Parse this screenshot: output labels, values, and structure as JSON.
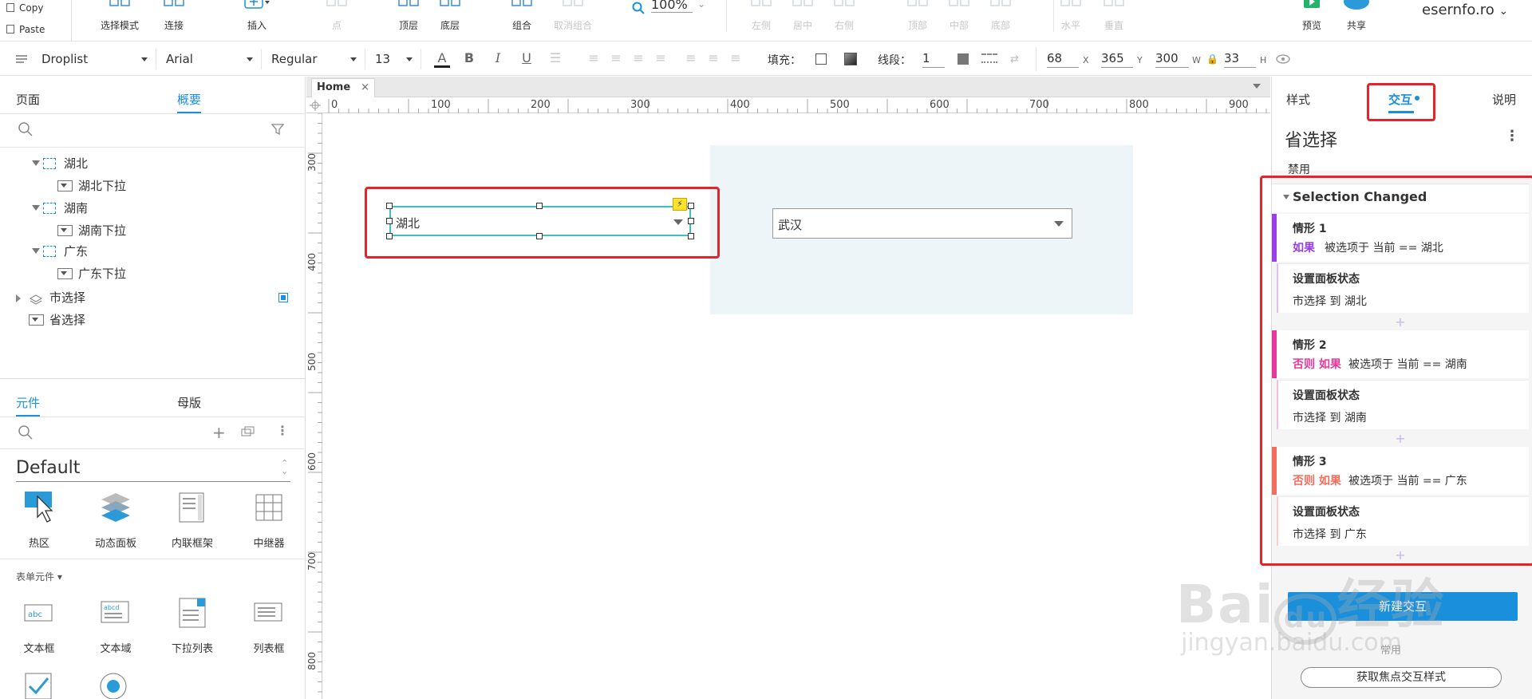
{
  "clipboard": {
    "copy_label": "Copy",
    "paste_label": "Paste"
  },
  "toolbar": {
    "tools": [
      {
        "label": "选择模式",
        "icon": "select-mode-icon"
      },
      {
        "label": "连接",
        "icon": "connect-icon"
      },
      {
        "label": "插入",
        "icon": "insert-icon"
      },
      {
        "label": "点",
        "icon": "point-icon"
      },
      {
        "label": "顶层",
        "icon": "bring-front-icon"
      },
      {
        "label": "底层",
        "icon": "send-back-icon"
      },
      {
        "label": "组合",
        "icon": "group-icon"
      },
      {
        "label": "取消组合",
        "icon": "ungroup-icon"
      },
      {
        "label": "左侧",
        "icon": "align-left-icon"
      },
      {
        "label": "居中",
        "icon": "align-center-icon"
      },
      {
        "label": "右侧",
        "icon": "align-right-icon"
      },
      {
        "label": "顶部",
        "icon": "align-top-icon"
      },
      {
        "label": "中部",
        "icon": "align-middle-icon"
      },
      {
        "label": "底部",
        "icon": "align-bottom-icon"
      },
      {
        "label": "水平",
        "icon": "distribute-h-icon"
      },
      {
        "label": "垂直",
        "icon": "distribute-v-icon"
      },
      {
        "label": "预览",
        "icon": "preview-icon"
      },
      {
        "label": "共享",
        "icon": "share-icon"
      }
    ],
    "zoom": "100%",
    "user": "esernfo.ro"
  },
  "format": {
    "widget_type": "Droplist",
    "font": "Arial",
    "weight": "Regular",
    "size": "13",
    "fill_label": "填充：",
    "stroke_label": "线段：",
    "stroke_value": "1",
    "x": "68",
    "x_label": "X",
    "y": "365",
    "y_label": "Y",
    "w": "300",
    "w_label": "W",
    "h": "33",
    "h_label": "H"
  },
  "left": {
    "tabs": [
      "页面",
      "概要"
    ],
    "outline": [
      {
        "label": "湖北",
        "kind": "panel"
      },
      {
        "label": "湖北下拉",
        "kind": "droplist"
      },
      {
        "label": "湖南",
        "kind": "panel"
      },
      {
        "label": "湖南下拉",
        "kind": "droplist"
      },
      {
        "label": "广东",
        "kind": "panel"
      },
      {
        "label": "广东下拉",
        "kind": "droplist"
      },
      {
        "label": "市选择",
        "kind": "dynamic-panel"
      },
      {
        "label": "省选择",
        "kind": "droplist"
      }
    ],
    "lib_tabs": [
      "元件",
      "母版"
    ],
    "library": "Default",
    "widgets": [
      "热区",
      "动态面板",
      "内联框架",
      "中继器"
    ],
    "form_section": "表单元件 ▾",
    "form_widgets": [
      "文本框",
      "文本域",
      "下拉列表",
      "列表框"
    ]
  },
  "canvas": {
    "tab": "Home",
    "ruler_h": [
      "0",
      "100",
      "200",
      "300",
      "400",
      "500",
      "600",
      "700",
      "800",
      "900"
    ],
    "ruler_v": [
      "300",
      "400",
      "500",
      "600",
      "700",
      "800"
    ],
    "province_value": "湖北",
    "city_value": "武汉"
  },
  "right": {
    "tabs": [
      "样式",
      "交互",
      "说明"
    ],
    "widget_name": "省选择",
    "disabled_label": "禁用",
    "event": "Selection Changed",
    "cases": [
      {
        "title": "情形 1",
        "cond_kw": "如果",
        "cond": "被选项于 当前 == 湖北",
        "action": "设置面板状态",
        "detail": "市选择 到 湖北",
        "color": "#9b3ee6"
      },
      {
        "title": "情形 2",
        "cond_kw": "否则 如果",
        "cond": "被选项于 当前 == 湖南",
        "action": "设置面板状态",
        "detail": "市选择 到 湖南",
        "color": "#e6399b"
      },
      {
        "title": "情形 3",
        "cond_kw": "否则 如果",
        "cond": "被选项于 当前 == 广东",
        "action": "设置面板状态",
        "detail": "市选择 到 广东",
        "color": "#f26d5b"
      }
    ],
    "new_interaction": "新建交互",
    "common_label": "常用",
    "focus_style": "获取焦点交互样式"
  },
  "colors": {
    "accent": "#1a8fdc",
    "highlight": "#e5232a",
    "panel_bg": "#eef5f8"
  }
}
